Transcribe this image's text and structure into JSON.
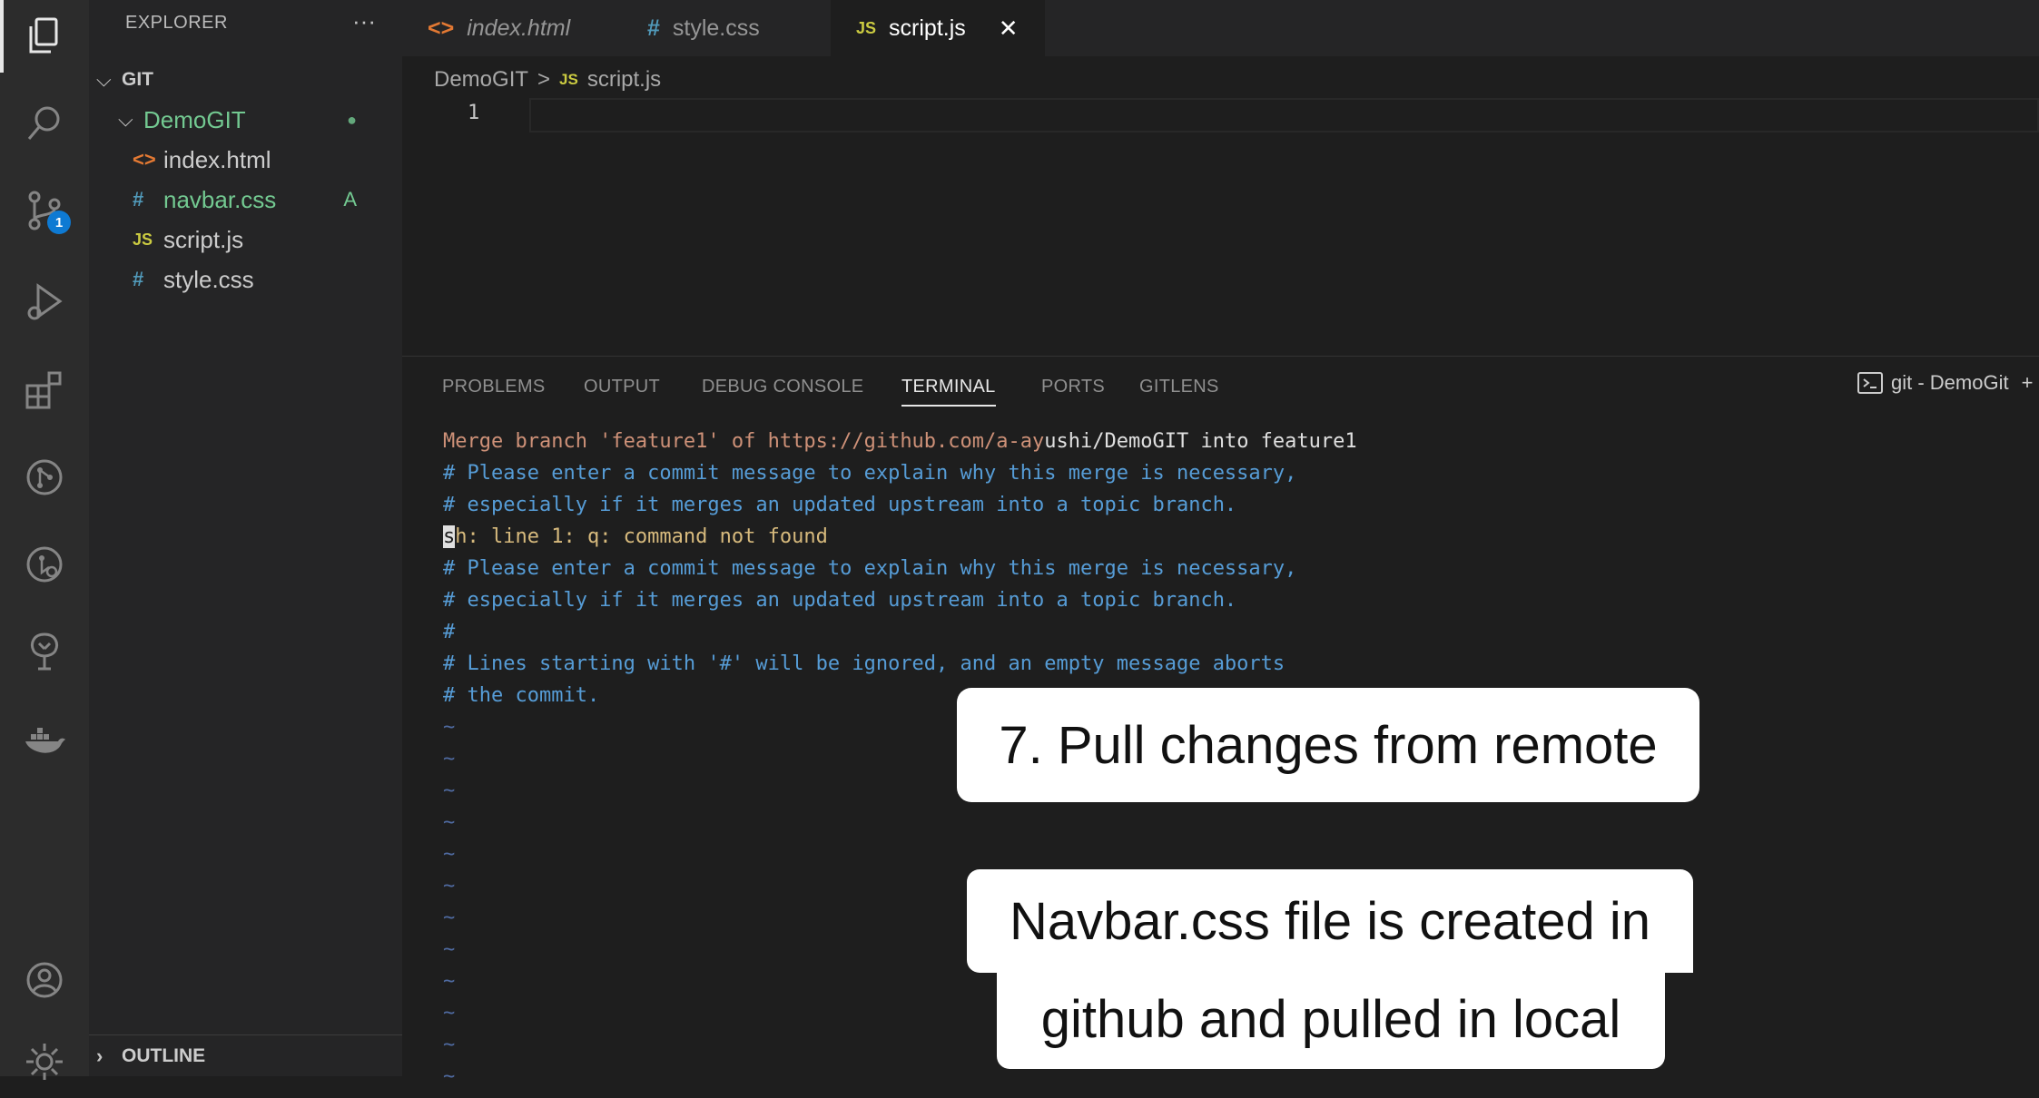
{
  "explorer": {
    "title": "EXPLORER",
    "more": "···",
    "root": "GIT",
    "folder": "DemoGIT",
    "folder_status": "●",
    "files": [
      {
        "name": "index.html",
        "icon": "<>",
        "status": ""
      },
      {
        "name": "navbar.css",
        "icon": "#",
        "status": "A"
      },
      {
        "name": "script.js",
        "icon": "JS",
        "status": ""
      },
      {
        "name": "style.css",
        "icon": "#",
        "status": ""
      }
    ],
    "outline": "OUTLINE"
  },
  "activity": {
    "source_control_badge": "1"
  },
  "tabs": [
    {
      "label": "index.html",
      "icon": "<>"
    },
    {
      "label": "style.css",
      "icon": "#"
    },
    {
      "label": "script.js",
      "icon": "JS",
      "close": "✕"
    }
  ],
  "breadcrumb": {
    "folder": "DemoGIT",
    "sep": ">",
    "icon": "JS",
    "file": "script.js"
  },
  "editor": {
    "line_number": "1"
  },
  "panel": {
    "tabs": [
      "PROBLEMS",
      "OUTPUT",
      "DEBUG CONSOLE",
      "TERMINAL",
      "PORTS",
      "GITLENS"
    ],
    "terminal_name": "git - DemoGit",
    "terminal_more": "+"
  },
  "terminal": {
    "merge_prefix": "Merge branch 'feature1' of https://github.com/a-ay",
    "merge_suffix": "ushi/DemoGIT into feature1",
    "comment1": "# Please enter a commit message to explain why this merge is necessary,",
    "comment2": "# especially if it merges an updated upstream into a topic branch.",
    "cursor_char": "s",
    "error_rest": "h: line 1: q: command not found",
    "comment3": "# Please enter a commit message to explain why this merge is necessary,",
    "comment4": "# especially if it merges an updated upstream into a topic branch.",
    "comment5": "#",
    "comment6": "# Lines starting with '#' will be ignored, and an empty message aborts",
    "comment7": "# the commit.",
    "tilde": "~"
  },
  "captions": {
    "step": "7. Pull changes from remote",
    "note_line1": "Navbar.css file is created in",
    "note_line2": "github and pulled in local"
  },
  "colors": {
    "accent_blue": "#0e7ad3",
    "added_green": "#73c991"
  }
}
